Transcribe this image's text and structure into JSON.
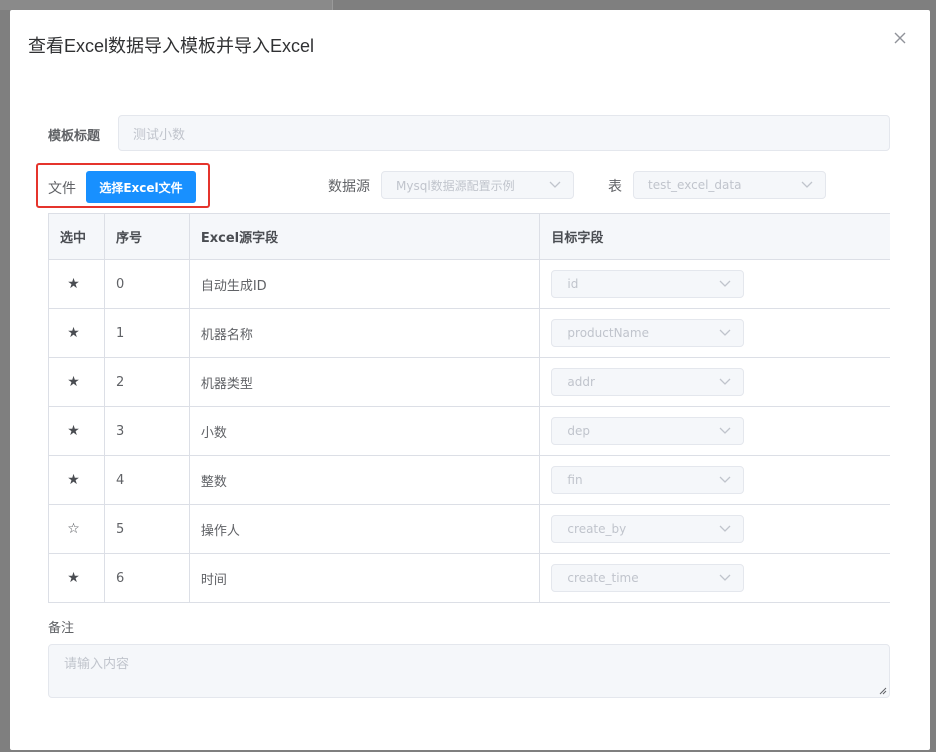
{
  "dialog": {
    "title": "查看Excel数据导入模板并导入Excel"
  },
  "form": {
    "template_title_label": "模板标题",
    "template_title_value": "测试小数",
    "file_label": "文件",
    "choose_file_button": "选择Excel文件",
    "datasource_label": "数据源",
    "datasource_value": "Mysql数据源配置示例",
    "table_label": "表",
    "table_value": "test_excel_data",
    "remark_label": "备注",
    "remark_placeholder": "请输入内容"
  },
  "mapping_table": {
    "columns": [
      "选中",
      "序号",
      "Excel源字段",
      "目标字段"
    ],
    "rows": [
      {
        "selected": "★",
        "index": "0",
        "source": "自动生成ID",
        "target": "id"
      },
      {
        "selected": "★",
        "index": "1",
        "source": "机器名称",
        "target": "productName"
      },
      {
        "selected": "★",
        "index": "2",
        "source": "机器类型",
        "target": "addr"
      },
      {
        "selected": "★",
        "index": "3",
        "source": "小数",
        "target": "dep"
      },
      {
        "selected": "★",
        "index": "4",
        "source": "整数",
        "target": "fin"
      },
      {
        "selected": "☆",
        "index": "5",
        "source": "操作人",
        "target": "create_by"
      },
      {
        "selected": "★",
        "index": "6",
        "source": "时间",
        "target": "create_time"
      }
    ]
  },
  "colors": {
    "primary": "#1890ff",
    "highlight": "#e5342c",
    "disabled_bg": "#f5f7fa"
  }
}
